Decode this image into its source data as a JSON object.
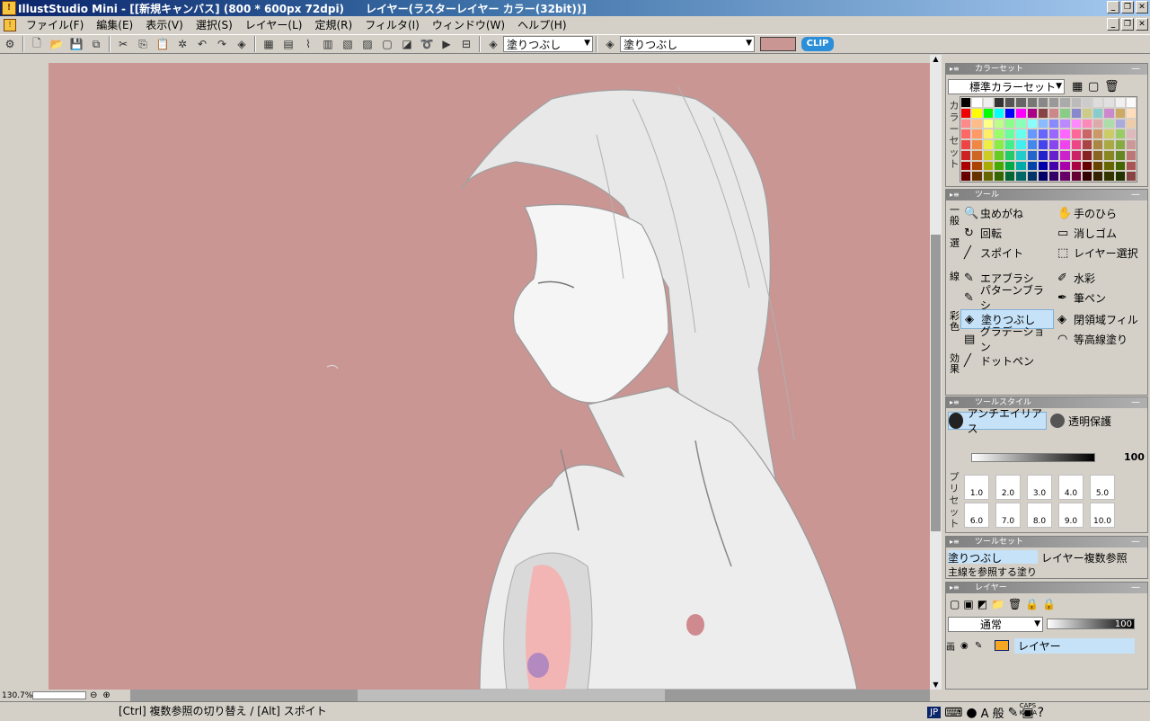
{
  "app": {
    "title": "IllustStudio Mini - [[新規キャンバス] (800 * 600px 72dpi)　　レイヤー(ラスターレイヤー カラー(32bit))]"
  },
  "menu": [
    "ファイル(F)",
    "編集(E)",
    "表示(V)",
    "選択(S)",
    "レイヤー(L)",
    "定規(R)",
    "フィルタ(I)",
    "ウィンドウ(W)",
    "ヘルプ(H)"
  ],
  "toolbar": {
    "tool_combo": "塗りつぶし",
    "subtool_combo": "塗りつぶし",
    "color_hex": "#c99694"
  },
  "canvas": {
    "background_hex": "#c99694",
    "zoom": "130.7%"
  },
  "status": {
    "text": "[Ctrl] 複数参照の切り替え / [Alt] スポイト",
    "ime_jp": "JP",
    "ime_mode": "A 般",
    "caps": "CAPS",
    "kana": "KANA"
  },
  "color_set": {
    "header": "カラーセット",
    "select": "標準カラーセット",
    "side": "カラーセット"
  },
  "tools": {
    "header": "ツール",
    "sections": {
      "general": "一般",
      "select": "選",
      "line": "線",
      "color": "彩色",
      "effect": "効果"
    },
    "general": [
      {
        "label": "虫めがね",
        "icon": "magnifier-icon",
        "g": "🔍"
      },
      {
        "label": "手のひら",
        "icon": "hand-icon",
        "g": "✋"
      },
      {
        "label": "回転",
        "icon": "rotate-icon",
        "g": "↻"
      },
      {
        "label": "消しゴム",
        "icon": "eraser-icon",
        "g": "▭"
      },
      {
        "label": "スポイト",
        "icon": "eyedropper-icon",
        "g": "╱"
      },
      {
        "label": "レイヤー選択",
        "icon": "layer-select-icon",
        "g": "⬚"
      }
    ],
    "line": [
      {
        "label": "エアブラシ",
        "icon": "airbrush-icon",
        "g": "✎"
      },
      {
        "label": "水彩",
        "icon": "watercolor-icon",
        "g": "✐"
      },
      {
        "label": "パターンブラシ",
        "icon": "pattern-brush-icon",
        "g": "✎"
      },
      {
        "label": "筆ペン",
        "icon": "brush-pen-icon",
        "g": "✒"
      }
    ],
    "color": [
      {
        "label": "塗りつぶし",
        "icon": "bucket-icon",
        "g": "◈",
        "active": true
      },
      {
        "label": "閉領域フィル",
        "icon": "closed-fill-icon",
        "g": "◈"
      },
      {
        "label": "グラデーション",
        "icon": "gradient-icon",
        "g": "▤"
      },
      {
        "label": "等高線塗り",
        "icon": "contour-icon",
        "g": "◠"
      }
    ],
    "effect": [
      {
        "label": "ドットペン",
        "icon": "dot-pen-icon",
        "g": "╱"
      }
    ]
  },
  "tool_style": {
    "header": "ツールスタイル",
    "antialias": "アンチエイリアス",
    "protect": "透明保護",
    "opacity_value": "100",
    "preset_label": "プリセット",
    "presets": [
      "1.0",
      "2.0",
      "3.0",
      "4.0",
      "5.0",
      "6.0",
      "7.0",
      "8.0",
      "9.0",
      "10.0"
    ]
  },
  "tool_set": {
    "header": "ツールセット",
    "item1": "塗りつぶし",
    "item2": "レイヤー複数参照",
    "item3": "主線を参照する塗り"
  },
  "layers": {
    "header": "レイヤー",
    "blend": "通常",
    "opacity": "100",
    "layer_name": "レイヤー"
  }
}
